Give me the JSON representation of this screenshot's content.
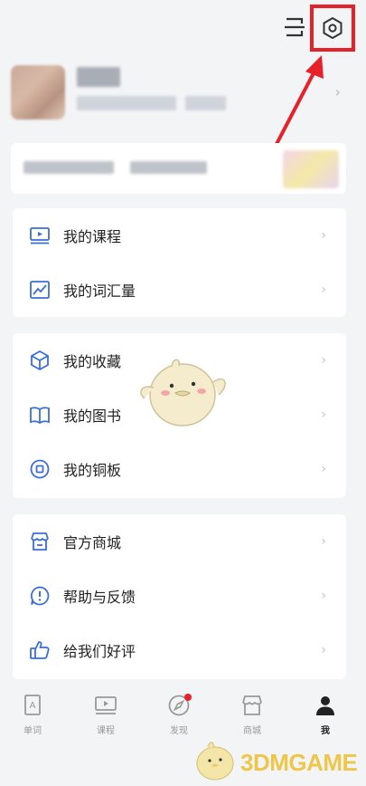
{
  "header": {
    "scan_icon": "scan-icon",
    "settings_icon": "gear-icon",
    "highlight_color": "#e8202a"
  },
  "menu_group_1": [
    {
      "label": "我的课程",
      "icon": "course-screen-icon"
    },
    {
      "label": "我的词汇量",
      "icon": "chart-trend-icon"
    }
  ],
  "menu_group_2": [
    {
      "label": "我的收藏",
      "icon": "cube-icon"
    },
    {
      "label": "我的图书",
      "icon": "book-icon"
    },
    {
      "label": "我的铜板",
      "icon": "coin-icon"
    }
  ],
  "menu_group_3": [
    {
      "label": "官方商城",
      "icon": "store-icon"
    },
    {
      "label": "帮助与反馈",
      "icon": "help-icon"
    },
    {
      "label": "给我们好评",
      "icon": "thumbs-up-icon"
    }
  ],
  "tabbar": [
    {
      "label": "单词",
      "icon": "word-card-icon"
    },
    {
      "label": "课程",
      "icon": "course-icon"
    },
    {
      "label": "发现",
      "icon": "compass-icon",
      "badge": true
    },
    {
      "label": "商城",
      "icon": "store-icon"
    },
    {
      "label": "我",
      "icon": "person-icon",
      "active": true
    }
  ],
  "watermark": {
    "text": "3DMGAME"
  },
  "accent_color": "#3a6fd8"
}
